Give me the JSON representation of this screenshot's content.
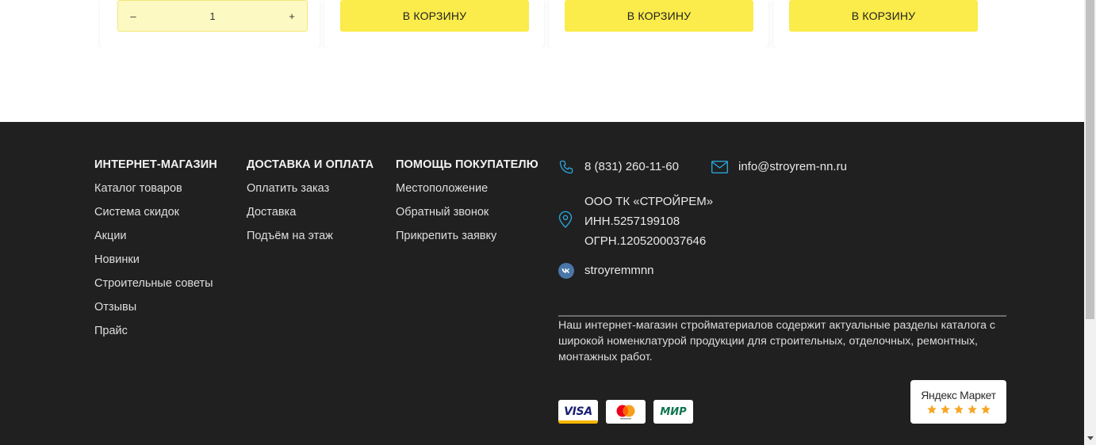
{
  "products": {
    "quantity": {
      "minus": "–",
      "value": "1",
      "plus": "+"
    },
    "add_to_cart_label": "В КОРЗИНУ"
  },
  "footer": {
    "columns": [
      {
        "title": "ИНТЕРНЕТ-МАГАЗИН",
        "items": [
          "Каталог товаров",
          "Система скидок",
          "Акции",
          "Новинки",
          "Строительные советы",
          "Отзывы",
          "Прайс"
        ]
      },
      {
        "title": "ДОСТАВКА И ОПЛАТА",
        "items": [
          "Оплатить заказ",
          "Доставка",
          "Подъём на этаж"
        ]
      },
      {
        "title": "ПОМОЩЬ ПОКУПАТЕЛЮ",
        "items": [
          "Местоположение",
          "Обратный звонок",
          "Прикрепить заявку"
        ]
      }
    ],
    "contacts": {
      "phone": "8 (831) 260-11-60",
      "email": "info@stroyrem-nn.ru",
      "company_name": "ООО ТК «СТРОЙРЕМ»",
      "inn": "ИНН.5257199108",
      "ogrn": "ОГРН.1205200037646",
      "vk": "stroyremmnn"
    },
    "description": "Наш интернет-магазин стройматериалов содержит актуальные разделы каталога с широкой номенклатурой продукции для строительных, отделочных, ремонтных, монтажных работ.",
    "payments": {
      "visa": "VISA",
      "mir": "МИР"
    },
    "yandex_market": {
      "title": "Яндекс Маркет",
      "rating": 5,
      "stars": 5
    }
  },
  "colors": {
    "accent_yellow": "#fbeb4b",
    "footer_bg": "#202020",
    "icon_blue": "#2aa3d8"
  }
}
